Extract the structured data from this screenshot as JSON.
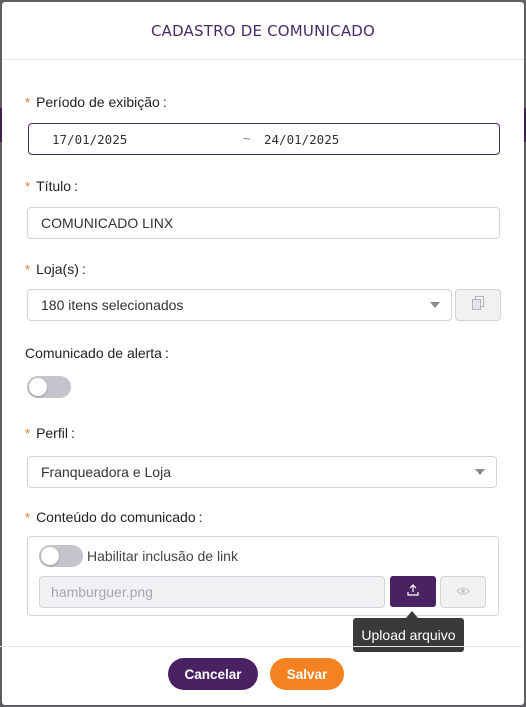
{
  "modal": {
    "title": "CADASTRO DE COMUNICADO"
  },
  "required_marker": "*",
  "periodo": {
    "label": "Período de exibição",
    "start": "17/01/2025",
    "separator": "~",
    "end": "24/01/2025"
  },
  "titulo": {
    "label": "Título",
    "value": "COMUNICADO LINX"
  },
  "lojas": {
    "label": "Loja(s)",
    "value": "180 itens selecionados"
  },
  "alerta": {
    "label": "Comunicado de alerta",
    "enabled": false
  },
  "perfil": {
    "label": "Perfil",
    "value": "Franqueadora e Loja"
  },
  "conteudo": {
    "label": "Conteúdo do comunicado",
    "link_toggle_label": "Habilitar inclusão de link",
    "link_enabled": false,
    "file_placeholder": "hamburguer.png",
    "upload_tooltip": "Upload arquivo"
  },
  "footer": {
    "cancel_label": "Cancelar",
    "save_label": "Salvar"
  },
  "colors": {
    "primary": "#4a2263",
    "accent": "#f58220",
    "required": "#e8761c"
  },
  "icons": {
    "copy": "copy-icon",
    "upload": "upload-icon",
    "view": "eye-icon",
    "dropdown": "caret-down-icon"
  }
}
